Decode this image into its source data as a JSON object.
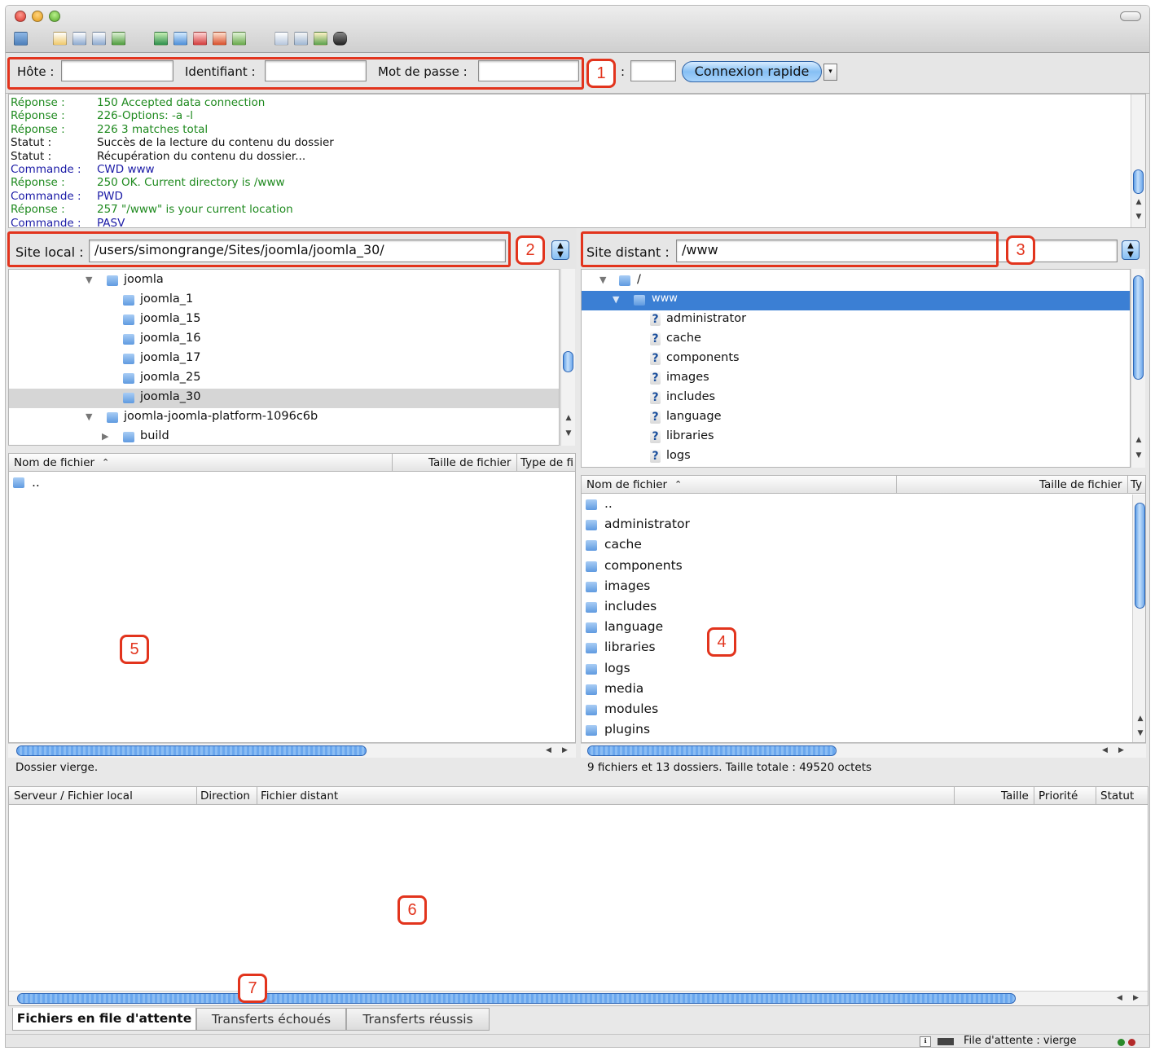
{
  "toolbar": {
    "icons": [
      "site-manager-icon",
      "message-log-toggle-icon",
      "local-tree-toggle-icon",
      "remote-tree-toggle-icon",
      "queue-toggle-icon",
      "refresh-icon",
      "process-queue-icon",
      "cancel-icon",
      "disconnect-icon",
      "reconnect-icon",
      "directory-filter-icon",
      "directory-compare-icon",
      "sync-browse-icon",
      "search-remote-icon"
    ]
  },
  "quickconnect": {
    "host_label": "Hôte :",
    "host_value": "",
    "user_label": "Identifiant :",
    "user_value": "",
    "pass_label": "Mot de passe :",
    "pass_value": "",
    "port_label": ":",
    "port_value": "",
    "connect_label": "Connexion rapide",
    "dropdown_glyph": "▾"
  },
  "log": [
    {
      "k": "Réponse :",
      "v": "150 Accepted data connection",
      "color": "#1f8a1f"
    },
    {
      "k": "Réponse :",
      "v": "226-Options: -a -l",
      "color": "#1f8a1f"
    },
    {
      "k": "Réponse :",
      "v": "226 3 matches total",
      "color": "#1f8a1f"
    },
    {
      "k": "Statut :",
      "v": "Succès de la lecture du contenu du dossier",
      "color": "#111111"
    },
    {
      "k": "Statut :",
      "v": "Récupération du contenu du dossier...",
      "color": "#111111"
    },
    {
      "k": "Commande :",
      "v": "CWD www",
      "color": "#1a1aa6"
    },
    {
      "k": "Réponse :",
      "v": "250 OK. Current directory is /www",
      "color": "#1f8a1f"
    },
    {
      "k": "Commande :",
      "v": "PWD",
      "color": "#1a1aa6"
    },
    {
      "k": "Réponse :",
      "v": "257 \"/www\" is your current location",
      "color": "#1f8a1f"
    },
    {
      "k": "Commande :",
      "v": "PASV",
      "color": "#1a1aa6"
    }
  ],
  "local": {
    "site_label": "Site local :",
    "path": "/users/simongrange/Sites/joomla/joomla_30/",
    "tree": [
      {
        "label": "joomla",
        "expanded": true,
        "selected": false,
        "level": 0
      },
      {
        "label": "joomla_1",
        "expanded": null,
        "selected": false,
        "level": 1
      },
      {
        "label": "joomla_15",
        "expanded": null,
        "selected": false,
        "level": 1
      },
      {
        "label": "joomla_16",
        "expanded": null,
        "selected": false,
        "level": 1
      },
      {
        "label": "joomla_17",
        "expanded": null,
        "selected": false,
        "level": 1
      },
      {
        "label": "joomla_25",
        "expanded": null,
        "selected": false,
        "level": 1
      },
      {
        "label": "joomla_30",
        "expanded": null,
        "selected": true,
        "level": 1
      },
      {
        "label": "joomla-joomla-platform-1096c6b",
        "expanded": true,
        "selected": false,
        "level": 0
      },
      {
        "label": "build",
        "expanded": false,
        "selected": false,
        "level": 1
      }
    ],
    "columns": {
      "name": "Nom de fichier",
      "size": "Taille de fichier",
      "type": "Type de fi"
    },
    "files": [
      ".."
    ],
    "status": "Dossier vierge."
  },
  "remote": {
    "site_label": "Site distant :",
    "path": "/www",
    "tree_root": "/",
    "tree_current": "www",
    "tree": [
      "administrator",
      "cache",
      "components",
      "images",
      "includes",
      "language",
      "libraries",
      "logs"
    ],
    "columns": {
      "name": "Nom de fichier",
      "size": "Taille de fichier",
      "type": "Ty"
    },
    "files": [
      "..",
      "administrator",
      "cache",
      "components",
      "images",
      "includes",
      "language",
      "libraries",
      "logs",
      "media",
      "modules",
      "plugins"
    ],
    "status": "9 fichiers et 13 dossiers. Taille totale : 49520 octets"
  },
  "queue": {
    "columns": {
      "server": "Serveur / Fichier local",
      "direction": "Direction",
      "remote": "Fichier distant",
      "size": "Taille",
      "priority": "Priorité",
      "status": "Statut"
    },
    "tabs": [
      "Fichiers en file d'attente",
      "Transferts échoués",
      "Transferts réussis"
    ]
  },
  "statusbar": {
    "queue_text": "File d'attente : vierge"
  },
  "annotations": [
    "1",
    "2",
    "3",
    "4",
    "5",
    "6",
    "7"
  ],
  "colors": {
    "accent": "#2b64b5",
    "annotation": "#e2341d",
    "selection": "#3b7fd4"
  }
}
